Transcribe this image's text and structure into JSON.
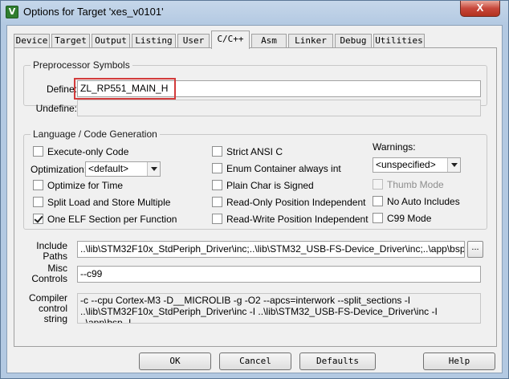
{
  "window": {
    "title": "Options for Target 'xes_v0101'",
    "icon": "keil-uvision-icon",
    "close_label": "X"
  },
  "tabs": [
    {
      "label": "Device"
    },
    {
      "label": "Target"
    },
    {
      "label": "Output"
    },
    {
      "label": "Listing"
    },
    {
      "label": "User"
    },
    {
      "label": "C/C++",
      "active": true
    },
    {
      "label": "Asm"
    },
    {
      "label": "Linker"
    },
    {
      "label": "Debug"
    },
    {
      "label": "Utilities"
    }
  ],
  "preprocessor": {
    "legend": "Preprocessor Symbols",
    "define_label": "Define:",
    "define_value": "ZL_RP551_MAIN_H",
    "undefine_label": "Undefine:",
    "undefine_value": ""
  },
  "language": {
    "legend": "Language / Code Generation",
    "execute_only_code": {
      "label": "Execute-only Code",
      "checked": false
    },
    "optimization_label": "Optimization:",
    "optimization_value": "<default>",
    "optimize_for_time": {
      "label": "Optimize for Time",
      "checked": false
    },
    "split_load_store": {
      "label": "Split Load and Store Multiple",
      "checked": false
    },
    "one_elf_section": {
      "label": "One ELF Section per Function",
      "checked": true
    },
    "strict_ansi_c": {
      "label": "Strict ANSI C",
      "checked": false
    },
    "enum_container": {
      "label": "Enum Container always int",
      "checked": false
    },
    "plain_char_signed": {
      "label": "Plain Char is Signed",
      "checked": false
    },
    "ro_position_independent": {
      "label": "Read-Only Position Independent",
      "checked": false
    },
    "rw_position_independent": {
      "label": "Read-Write Position Independent",
      "checked": false
    },
    "warnings_label": "Warnings:",
    "warnings_value": "<unspecified>",
    "thumb_mode": {
      "label": "Thumb Mode",
      "checked": false,
      "disabled": true
    },
    "no_auto_includes": {
      "label": "No Auto Includes",
      "checked": false
    },
    "c99_mode": {
      "label": "C99 Mode",
      "checked": false
    }
  },
  "paths": {
    "include_label_1": "Include",
    "include_label_2": "Paths",
    "include_value": "..\\lib\\STM32F10x_StdPeriph_Driver\\inc;..\\lib\\STM32_USB-FS-Device_Driver\\inc;..\\app\\bsp;..\\app\\",
    "browse_label": "...",
    "misc_label_1": "Misc",
    "misc_label_2": "Controls",
    "misc_value": "--c99",
    "compiler_label_1": "Compiler",
    "compiler_label_2": "control",
    "compiler_label_3": "string",
    "compiler_value": "-c --cpu Cortex-M3 -D__MICROLIB -g -O2 --apcs=interwork --split_sections -I ..\\lib\\STM32F10x_StdPeriph_Driver\\inc -I ..\\lib\\STM32_USB-FS-Device_Driver\\inc -I ..\\app\\bsp -I .."
  },
  "buttons": {
    "ok": "OK",
    "cancel": "Cancel",
    "defaults": "Defaults",
    "help": "Help"
  },
  "colors": {
    "highlight_box": "#d23b3b",
    "title_bar": "#b3c9e2"
  }
}
